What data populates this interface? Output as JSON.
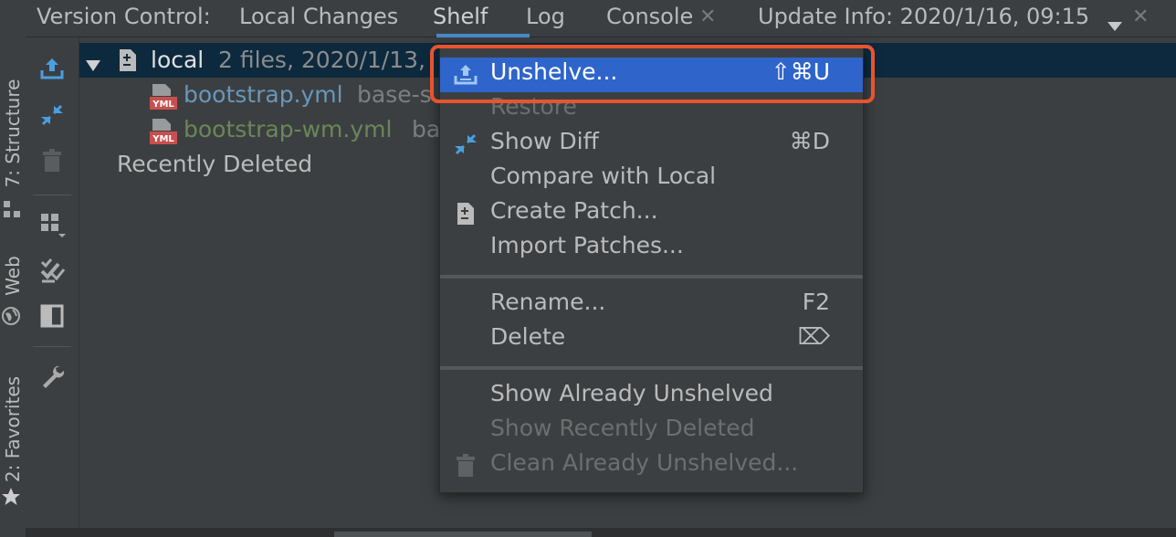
{
  "left_stripe": {
    "tabs": [
      {
        "label": "7: Structure"
      },
      {
        "label": "Web"
      },
      {
        "label": "2: Favorites"
      }
    ]
  },
  "tabbar": {
    "title": "Version Control:",
    "tabs": [
      {
        "label": "Local Changes"
      },
      {
        "label": "Shelf",
        "selected": true
      },
      {
        "label": "Log"
      },
      {
        "label": "Console"
      }
    ],
    "update_info": "Update Info: 2020/1/16, 09:15"
  },
  "toolbar": {
    "icons": [
      "unshelve-icon",
      "show-diff-icon",
      "delete-icon",
      "group-by-icon",
      "checklist-icon",
      "preview-icon",
      "settings-wrench-icon"
    ]
  },
  "tree": {
    "root": {
      "name": "local",
      "detail": "2 files, 2020/1/13,"
    },
    "files": [
      {
        "name": "bootstrap.yml",
        "path": "base-s",
        "color": "#6897bb",
        "icon": "yml-file-icon"
      },
      {
        "name": "bootstrap-wm.yml",
        "path": "ba",
        "color": "#6a8759",
        "icon": "yml-file-icon"
      }
    ],
    "recently_deleted": "Recently Deleted"
  },
  "menu": {
    "items": [
      {
        "label": "Unshelve...",
        "shortcut": "⇧⌘U",
        "icon": "unshelve-icon",
        "selected": true
      },
      {
        "label": "Restore",
        "shortcut": "",
        "disabled": true
      },
      {
        "label": "Show Diff",
        "shortcut": "⌘D",
        "icon": "show-diff-icon"
      },
      {
        "label": "Compare with Local",
        "shortcut": ""
      },
      {
        "label": "Create Patch...",
        "shortcut": "",
        "icon": "patch-icon"
      },
      {
        "label": "Import Patches...",
        "shortcut": ""
      },
      {
        "label": "Rename...",
        "shortcut": "F2"
      },
      {
        "label": "Delete",
        "shortcut": "⌦"
      },
      {
        "label": "Show Already Unshelved",
        "shortcut": ""
      },
      {
        "label": "Show Recently Deleted",
        "shortcut": "",
        "disabled": true
      },
      {
        "label": "Clean Already Unshelved...",
        "shortcut": "",
        "icon": "trash-icon",
        "disabled": true
      }
    ]
  },
  "colors": {
    "selection": "#2f65ca",
    "highlight_box": "#e8542d",
    "tab_underline": "#4a88c7"
  }
}
